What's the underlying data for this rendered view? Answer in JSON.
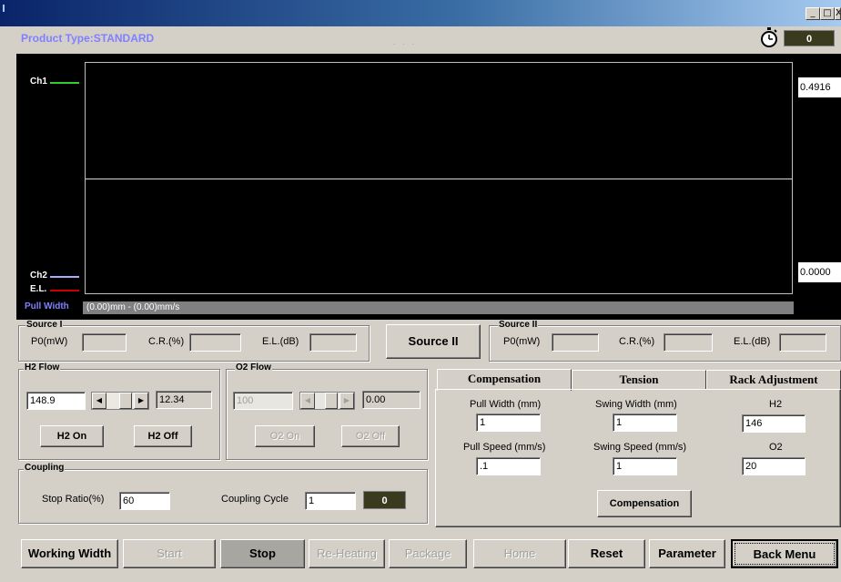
{
  "window": {
    "controls": {
      "minimize": "_",
      "maximize": "□",
      "close": "X"
    }
  },
  "header": {
    "product_type": "Product Type:STANDARD",
    "dots": ". . .",
    "stopwatch_icon": "stopwatch-icon",
    "counter": "0"
  },
  "graph": {
    "ch1_label": "Ch1",
    "ch2_label": "Ch2",
    "el_label": "E.L.",
    "pull_width_label": "Pull Width",
    "pull_width_value": "(0.00)mm - (0.00)mm/s",
    "y_top_value": "0.4916",
    "y_bottom_value": "0.0000",
    "colors": {
      "ch1": "#33cc33",
      "ch2": "#aaaaff",
      "el": "#cc0000",
      "pull_width_label": "#8080ff"
    }
  },
  "source1": {
    "title": "Source I",
    "p0_label": "P0(mW)",
    "p0_value": "",
    "cr_label": "C.R.(%)",
    "cr_value": "",
    "el_label": "E.L.(dB)",
    "el_value": ""
  },
  "source2_button": "Source II",
  "source2": {
    "title": "Source II",
    "p0_label": "P0(mW)",
    "p0_value": "",
    "cr_label": "C.R.(%)",
    "cr_value": "",
    "el_label": "E.L.(dB)",
    "el_value": ""
  },
  "h2_flow": {
    "title": "H2 Flow",
    "setpoint": "148.9",
    "readout": "12.34",
    "on_label": "H2 On",
    "off_label": "H2 Off"
  },
  "o2_flow": {
    "title": "O2 Flow",
    "setpoint": "100",
    "readout": "0.00",
    "on_label": "O2 On",
    "off_label": "O2 Off"
  },
  "coupling": {
    "title": "Coupling",
    "stop_ratio_label": "Stop Ratio(%)",
    "stop_ratio_value": "60",
    "cycle_label": "Coupling Cycle",
    "cycle_value": "1",
    "cycle_counter": "0"
  },
  "tabs": {
    "items": [
      "Compensation",
      "Tension",
      "Rack Adjustment"
    ],
    "active": "Compensation"
  },
  "compensation": {
    "pull_width_label": "Pull Width (mm)",
    "pull_width_value": "1",
    "swing_width_label": "Swing Width (mm)",
    "swing_width_value": "1",
    "h2_label": "H2",
    "h2_value": "146",
    "pull_speed_label": "Pull Speed (mm/s)",
    "pull_speed_value": ".1",
    "swing_speed_label": "Swing Speed (mm/s)",
    "swing_speed_value": "1",
    "o2_label": "O2",
    "o2_value": "20",
    "button": "Compensation"
  },
  "bottom_buttons": {
    "working_width": "Working Width",
    "start": "Start",
    "stop": "Stop",
    "reheating": "Re-Heating",
    "package": "Package",
    "home": "Home",
    "reset": "Reset",
    "parameter": "Parameter",
    "back_menu": "Back Menu"
  }
}
